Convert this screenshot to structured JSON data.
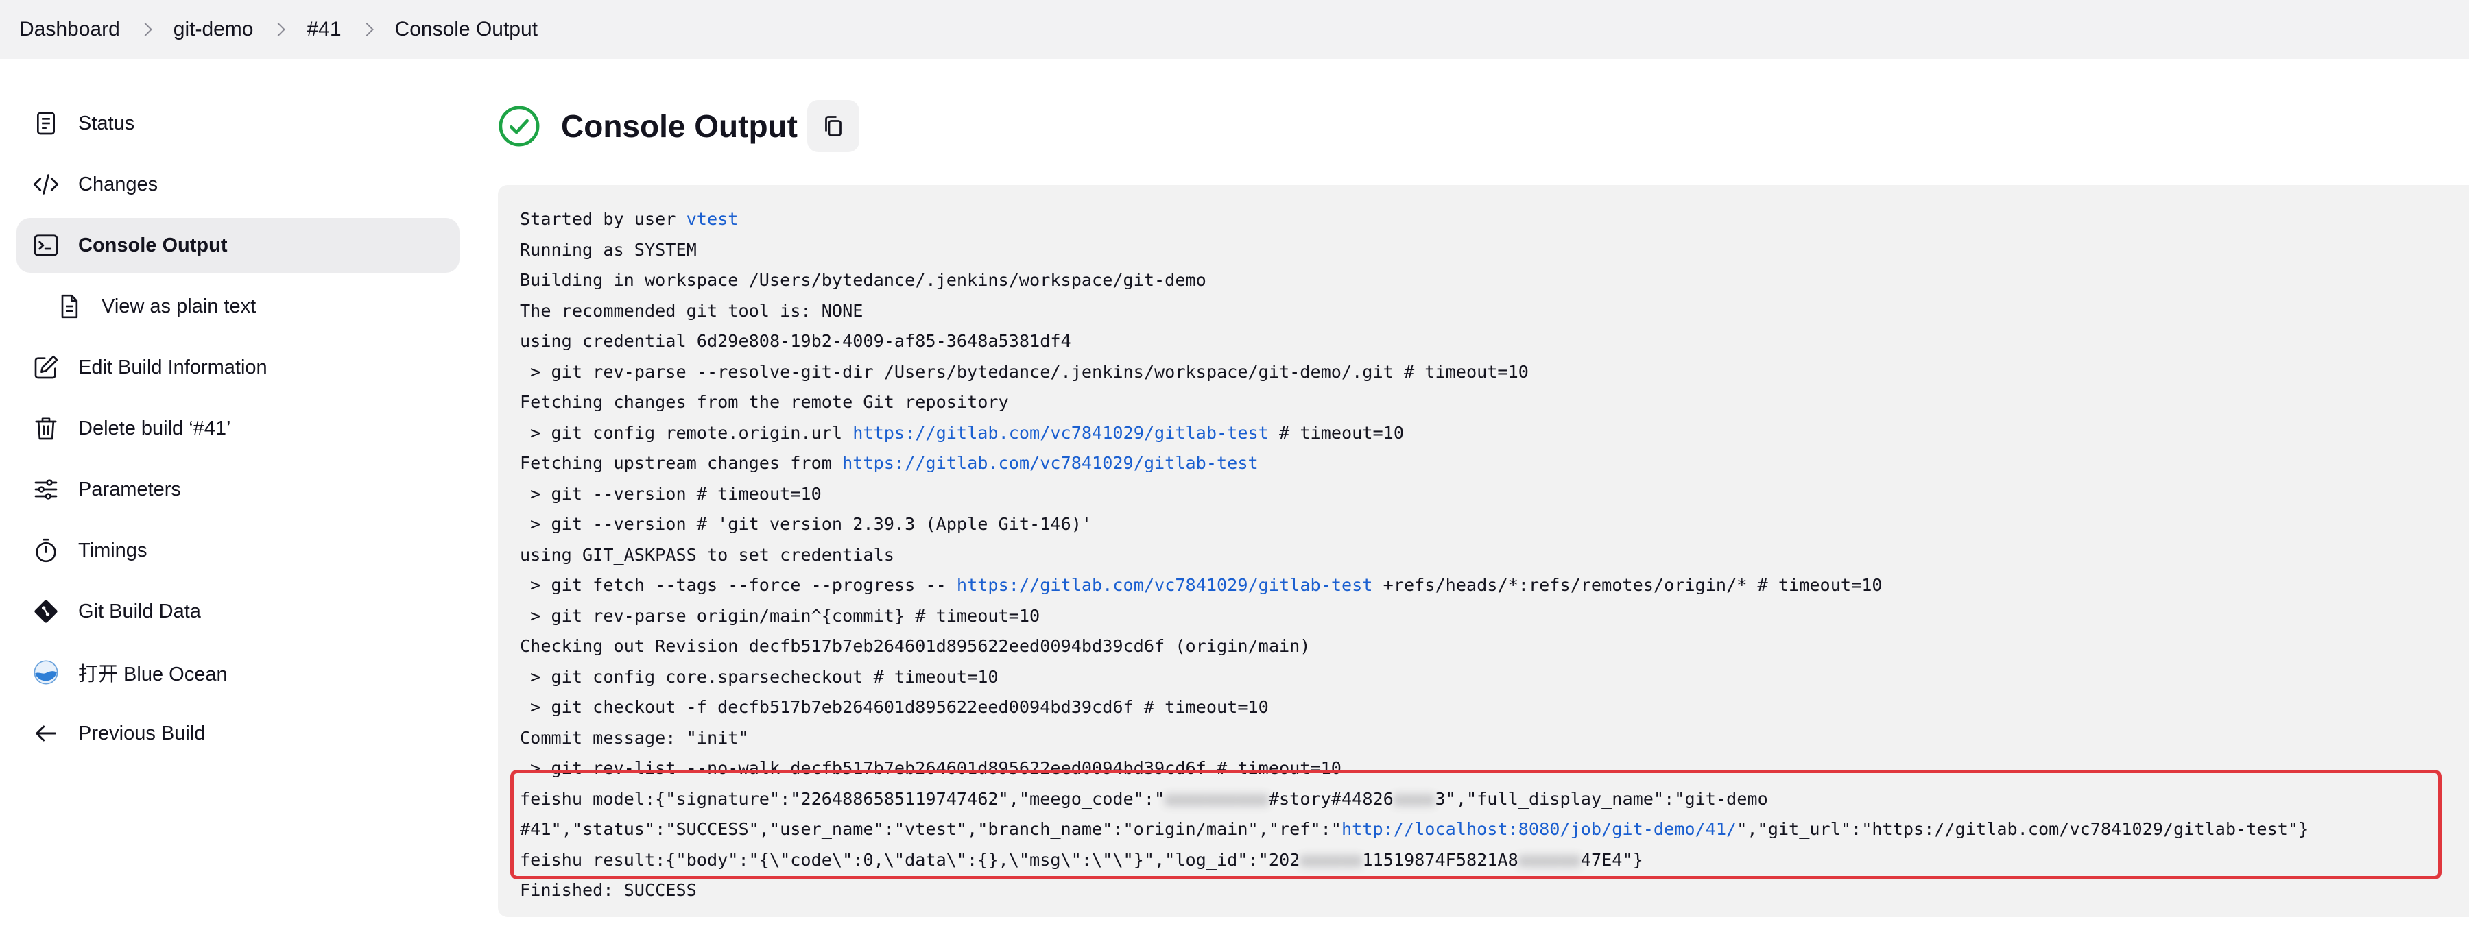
{
  "breadcrumb": [
    "Dashboard",
    "git-demo",
    "#41",
    "Console Output"
  ],
  "sidebar": {
    "items": [
      {
        "label": "Status",
        "icon": "document-icon"
      },
      {
        "label": "Changes",
        "icon": "code-icon"
      },
      {
        "label": "Console Output",
        "icon": "terminal-icon",
        "active": true
      },
      {
        "label": "View as plain text",
        "icon": "text-file-icon"
      },
      {
        "label": "Edit Build Information",
        "icon": "edit-icon"
      },
      {
        "label": "Delete build ‘#41’",
        "icon": "trash-icon"
      },
      {
        "label": "Parameters",
        "icon": "sliders-icon"
      },
      {
        "label": "Timings",
        "icon": "stopwatch-icon"
      },
      {
        "label": "Git Build Data",
        "icon": "git-icon"
      },
      {
        "label": "打开 Blue Ocean",
        "icon": "blue-ocean-icon"
      },
      {
        "label": "Previous Build",
        "icon": "arrow-left-icon"
      }
    ]
  },
  "header": {
    "title": "Console Output"
  },
  "console": {
    "user": "vtest",
    "lines": {
      "l1_prefix": "Started by user ",
      "l2": "Running as SYSTEM",
      "l3": "Building in workspace /Users/bytedance/.jenkins/workspace/git-demo",
      "l4": "The recommended git tool is: NONE",
      "l5": "using credential 6d29e808-19b2-4009-af85-3648a5381df4",
      "l6": " > git rev-parse --resolve-git-dir /Users/bytedance/.jenkins/workspace/git-demo/.git # timeout=10",
      "l7": "Fetching changes from the remote Git repository",
      "l8_prefix": " > git config remote.origin.url ",
      "l8_link": "https://gitlab.com/vc7841029/gitlab-test",
      "l8_suffix": " # timeout=10",
      "l9_prefix": "Fetching upstream changes from ",
      "l9_link": "https://gitlab.com/vc7841029/gitlab-test",
      "l10": " > git --version # timeout=10",
      "l11": " > git --version # 'git version 2.39.3 (Apple Git-146)'",
      "l12": "using GIT_ASKPASS to set credentials",
      "l13_prefix": " > git fetch --tags --force --progress -- ",
      "l13_link": "https://gitlab.com/vc7841029/gitlab-test",
      "l13_suffix": " +refs/heads/*:refs/remotes/origin/* # timeout=10",
      "l14": " > git rev-parse origin/main^{commit} # timeout=10",
      "l15": "Checking out Revision decfb517b7eb264601d895622eed0094bd39cd6f (origin/main)",
      "l16": " > git config core.sparsecheckout # timeout=10",
      "l17": " > git checkout -f decfb517b7eb264601d895622eed0094bd39cd6f # timeout=10",
      "l18": "Commit message: \"init\"",
      "l19": " > git rev-list --no-walk decfb517b7eb264601d895622eed0094bd39cd6f # timeout=10",
      "l20_a": "feishu model:{\"signature\":\"2264886585119747462\",\"meego_code\":\"",
      "l20_blur1": "xxxxxxxxxx",
      "l20_b": "#story#44826",
      "l20_blur2": "xxxx",
      "l20_c": "3\",\"full_display_name\":\"git-demo",
      "l21_prefix": "#41\",\"status\":\"SUCCESS\",\"user_name\":\"vtest\",\"branch_name\":\"origin/main\",\"ref\":\"",
      "l21_link": "http://localhost:8080/job/git-demo/41/",
      "l21_suffix": "\",\"git_url\":\"https://gitlab.com/vc7841029/gitlab-test\"}",
      "l22_a": "feishu result:{\"body\":\"{\\\"code\\\":0,\\\"data\\\":{},\\\"msg\\\":\\\"\\\"}\",\"log_id\":\"202",
      "l22_blur1": "xxxxxx",
      "l22_b": "11519874F5821A8",
      "l22_blur2": "xxxxxx",
      "l22_c": "47E4\"}",
      "l23": "Finished: SUCCESS"
    }
  },
  "colors": {
    "success": "#1ea446",
    "link": "#1a5fd0",
    "highlight_border": "#e0383e",
    "console_bg": "#f2f2f2"
  }
}
